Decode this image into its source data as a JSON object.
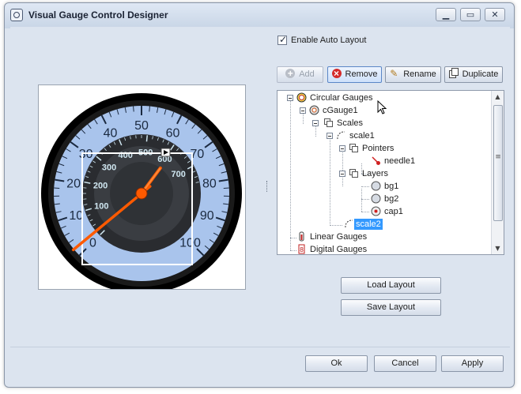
{
  "window": {
    "title": "Visual Gauge Control Designer",
    "caption_buttons": [
      "minimize-icon",
      "maximize-icon",
      "close-icon"
    ]
  },
  "options": {
    "auto_layout_label": "Enable Auto Layout",
    "auto_layout_checked": true
  },
  "toolbar": {
    "add_label": "Add",
    "remove_label": "Remove",
    "rename_label": "Rename",
    "duplicate_label": "Duplicate"
  },
  "tree": {
    "nodes": [
      {
        "label": "Circular Gauges",
        "icon": "circular-gauge-icon"
      },
      {
        "label": "cGauge1",
        "icon": "gauge-icon"
      },
      {
        "label": "Scales",
        "icon": "folder-icon"
      },
      {
        "label": "scale1",
        "icon": "scale-icon"
      },
      {
        "label": "Pointers",
        "icon": "folder-icon"
      },
      {
        "label": "needle1",
        "icon": "needle-icon"
      },
      {
        "label": "Layers",
        "icon": "folder-icon"
      },
      {
        "label": "bg1",
        "icon": "layer-icon"
      },
      {
        "label": "bg2",
        "icon": "layer-icon"
      },
      {
        "label": "cap1",
        "icon": "cap-icon"
      },
      {
        "label": "scale2",
        "icon": "scale-icon",
        "selected": true
      },
      {
        "label": "Linear Gauges",
        "icon": "linear-gauge-icon"
      },
      {
        "label": "Digital Gauges",
        "icon": "digital-gauge-icon"
      }
    ]
  },
  "layout_buttons": {
    "load_label": "Load Layout",
    "save_label": "Save Layout"
  },
  "dialog_buttons": {
    "ok_label": "Ok",
    "cancel_label": "Cancel",
    "apply_label": "Apply"
  },
  "gauge": {
    "outer_scale_labels": [
      "0",
      "10",
      "20",
      "30",
      "40",
      "50",
      "60",
      "70",
      "80",
      "90",
      "100"
    ],
    "inner_scale_labels": [
      "100",
      "200",
      "300",
      "400",
      "500",
      "600",
      "700"
    ],
    "outer_value": 2,
    "inner_value": 610,
    "colors": {
      "bezel": "#000000",
      "dial_face": "#a9c4ec",
      "inner_face": "#2a2c30",
      "needle": "#ff5a00",
      "selection_frame": "#ffffff"
    }
  }
}
